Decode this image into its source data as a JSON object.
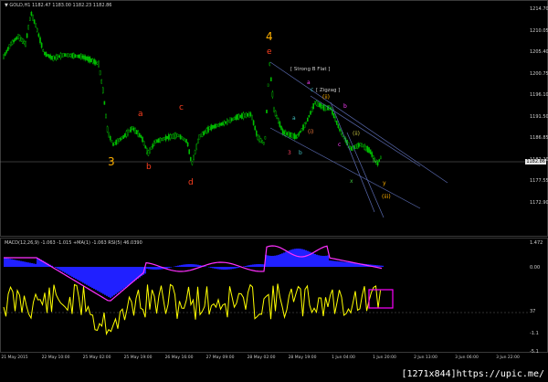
{
  "main": {
    "title": "▼ GOLD,H1  1182.47 1183.00 1182.23 1182.86",
    "price_axis": [
      "1214.70",
      "1210.05",
      "1205.40",
      "1200.75",
      "1196.10",
      "1191.50",
      "1186.85",
      "1182.20",
      "1177.55",
      "1172.90"
    ],
    "current_price_tag": "1182.86",
    "labels": {
      "strong_b_flat": "[ Strong B Flat ]",
      "zigzag": "[ Zigzag ]"
    },
    "wave_marks": {
      "w3": "3",
      "w4": "4",
      "a": "a",
      "b": "b",
      "c": "c",
      "d": "d",
      "e": "e",
      "s_a": "a",
      "s_b": "b",
      "s_c": "c",
      "s_ii": "(ii)",
      "s_i": "(i)",
      "s_iii": "(iii)",
      "s_3": "3",
      "s_a2": "a",
      "s_b2": "b",
      "s_c2": "c",
      "s_x": "x",
      "s_y": "y",
      "s_ii2": "(ii)",
      "s_iv": "iv"
    },
    "colors": {
      "candle": "#00c000",
      "wave_major": "#ffb000",
      "wave_minor": "#ff4020",
      "channel": "#5a6ab0"
    }
  },
  "indicator": {
    "title": "MACD(12,26,9) -1.063 -1.015   +MA(1) -1.063   RSI(5) 46.0390",
    "axis": [
      "1.472",
      "0.00",
      "37",
      "-1.1",
      "-5.1"
    ],
    "colors": {
      "histogram": "#2020ff",
      "macd": "#ff30ff",
      "rsi": "#ffff00",
      "highlight_box": "#ff00ff"
    }
  },
  "time_axis": [
    "21 May 2015",
    "22 May 10:00",
    "25 May 02:00",
    "25 May 19:00",
    "26 May 16:00",
    "27 May 09:00",
    "28 May 02:00",
    "28 May 19:00",
    "1 Jun 04:00",
    "1 Jun 20:00",
    "2 Jun 13:00",
    "3 Jun 06:00",
    "3 Jun 22:00"
  ],
  "watermark": "[1271x844]https://upic.me/"
}
